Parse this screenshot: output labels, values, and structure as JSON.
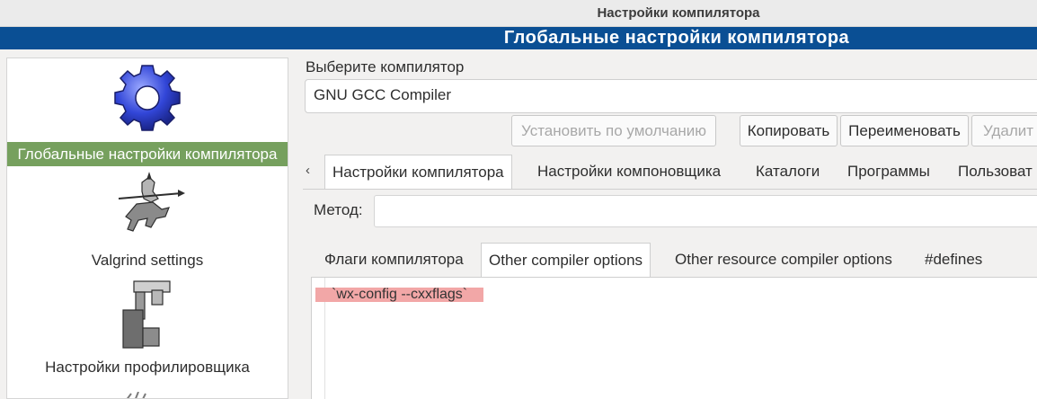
{
  "window": {
    "title": "Настройки компилятора"
  },
  "banner": {
    "title": "Глобальные настройки компилятора"
  },
  "sidebar": {
    "items": [
      {
        "label": "Глобальные настройки компилятора",
        "icon": "gear-icon",
        "selected": true
      },
      {
        "label": "Valgrind settings",
        "icon": "valgrind-knight-icon",
        "selected": false
      },
      {
        "label": "Настройки профилировщика",
        "icon": "caliper-icon",
        "selected": false
      }
    ]
  },
  "compiler": {
    "select_label": "Выберите компилятор",
    "selected": "GNU GCC Compiler",
    "buttons": {
      "set_default": "Установить по умолчанию",
      "copy": "Копировать",
      "rename": "Переименовать",
      "delete": "Удалит"
    }
  },
  "tabs": [
    {
      "label": "Настройки компилятора",
      "active": true
    },
    {
      "label": "Настройки компоновщика",
      "active": false
    },
    {
      "label": "Каталоги",
      "active": false
    },
    {
      "label": "Программы",
      "active": false
    },
    {
      "label": "Пользоват",
      "active": false
    }
  ],
  "method": {
    "label": "Метод:",
    "value": ""
  },
  "inner_tabs": [
    {
      "label": "Флаги компилятора",
      "active": false
    },
    {
      "label": "Other compiler options",
      "active": true
    },
    {
      "label": "Other resource compiler options",
      "active": false
    },
    {
      "label": "#defines",
      "active": false
    }
  ],
  "editor": {
    "text": "`wx-config --cxxflags`",
    "highlight_color": "#f2a7a7"
  },
  "colors": {
    "banner": "#0a4f94",
    "selection": "#76a05e"
  }
}
